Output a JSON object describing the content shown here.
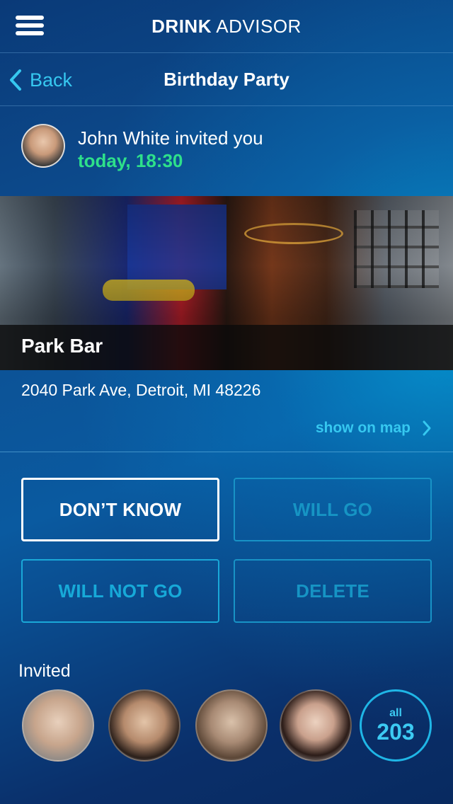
{
  "header": {
    "brand_bold": "DRINK",
    "brand_light": "ADVISOR",
    "menu_icon": "hamburger-icon"
  },
  "nav": {
    "back_label": "Back",
    "title": "Birthday Party"
  },
  "invite": {
    "text": "John White invited you",
    "time": "today, 18:30"
  },
  "venue": {
    "name": "Park Bar",
    "address": "2040 Park Ave, Detroit, MI 48226",
    "map_link": "show on map"
  },
  "actions": {
    "dont_know": "DON’T KNOW",
    "will_go": "WILL GO",
    "will_not_go": "WILL NOT GO",
    "delete": "DELETE"
  },
  "invited": {
    "label": "Invited",
    "all_label": "all",
    "count": "203"
  },
  "colors": {
    "accent": "#36c8f0",
    "time_green": "#2ee08a",
    "background": "#0a4a8c"
  }
}
